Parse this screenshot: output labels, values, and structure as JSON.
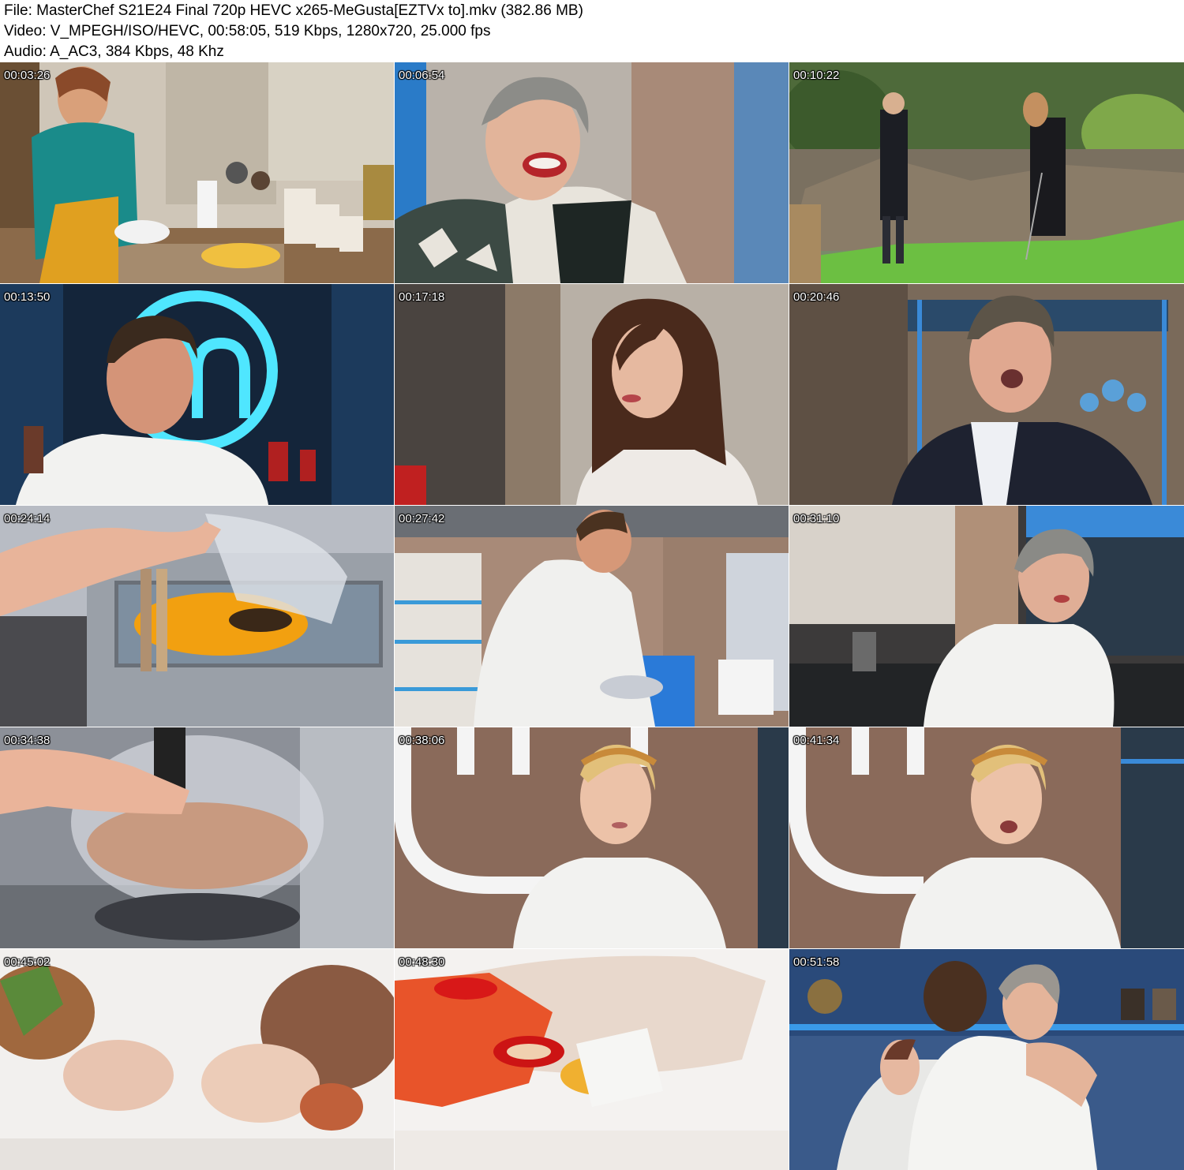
{
  "header": {
    "file_line": "File: MasterChef S21E24 Final 720p HEVC x265-MeGusta[EZTVx to].mkv (382.86 MB)",
    "video_line": "Video: V_MPEGH/ISO/HEVC, 00:58:05, 519 Kbps, 1280x720, 25.000 fps",
    "audio_line": "Audio: A_AC3, 384 Kbps, 48 Khz"
  },
  "thumbnails": [
    {
      "timestamp": "00:03:26"
    },
    {
      "timestamp": "00:06:54"
    },
    {
      "timestamp": "00:10:22"
    },
    {
      "timestamp": "00:13:50"
    },
    {
      "timestamp": "00:17:18"
    },
    {
      "timestamp": "00:20:46"
    },
    {
      "timestamp": "00:24:14"
    },
    {
      "timestamp": "00:27:42"
    },
    {
      "timestamp": "00:31:10"
    },
    {
      "timestamp": "00:34:38"
    },
    {
      "timestamp": "00:38:06"
    },
    {
      "timestamp": "00:41:34"
    },
    {
      "timestamp": "00:45:02"
    },
    {
      "timestamp": "00:48:30"
    },
    {
      "timestamp": "00:51:58"
    }
  ]
}
